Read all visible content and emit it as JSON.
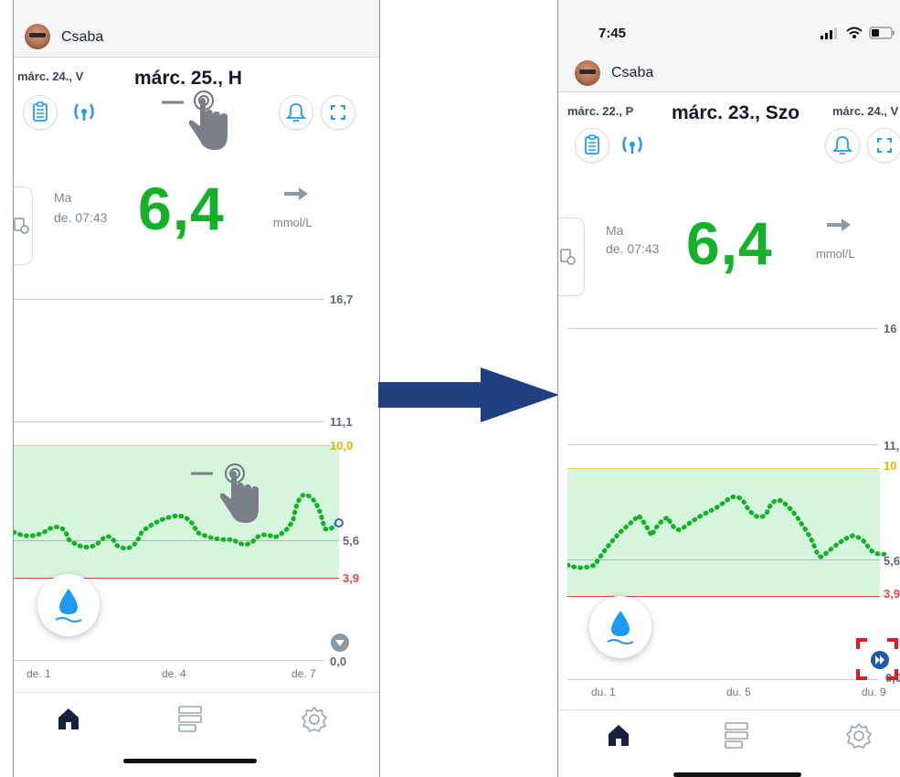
{
  "left_phone": {
    "user_name": "Csaba",
    "prev_date": "márc. 24., V",
    "current_date": "márc. 25., H",
    "reading_day": "Ma",
    "reading_time": "de. 07:43",
    "glucose_value": "6,4",
    "glucose_unit": "mmol/L",
    "y_labels": [
      "16,7",
      "11,1",
      "10,0",
      "5,6",
      "3,9",
      "0,0"
    ],
    "x_labels": [
      "de. 1",
      "de. 4",
      "de. 7"
    ],
    "icons": [
      "logbook-icon",
      "sensor-signal-icon",
      "bell-icon",
      "fullscreen-icon",
      "report-icon",
      "swipe-hand-icon",
      "water-drop-icon",
      "scroll-down-icon",
      "home-icon",
      "history-icon",
      "settings-icon"
    ]
  },
  "right_phone": {
    "status_time": "7:45",
    "user_name": "Csaba",
    "prev_date": "márc. 22., P",
    "current_date": "márc. 23., Szo",
    "next_date": "márc. 24., V",
    "reading_day": "Ma",
    "reading_time": "de. 07:43",
    "glucose_value": "6,4",
    "glucose_unit": "mmol/L",
    "y_labels": [
      "16",
      "11,",
      "10",
      "5,6",
      "3,9",
      "0,0"
    ],
    "x_labels": [
      "du. 1",
      "du. 5",
      "du. 9"
    ],
    "icons": [
      "logbook-icon",
      "sensor-signal-icon",
      "bell-icon",
      "fullscreen-icon",
      "report-icon",
      "water-drop-icon",
      "fast-forward-icon",
      "home-icon",
      "history-icon",
      "settings-icon",
      "signal-bars-icon",
      "wifi-icon",
      "battery-icon"
    ]
  },
  "colors": {
    "glucose_green": "#15b229",
    "target_band": "#d6f5dd",
    "high_limit": "#f2d339",
    "low_limit": "#e64848",
    "accent_blue": "#1e9bf0",
    "transition_arrow": "#1f3f80",
    "highlight_red": "#e51b23"
  }
}
